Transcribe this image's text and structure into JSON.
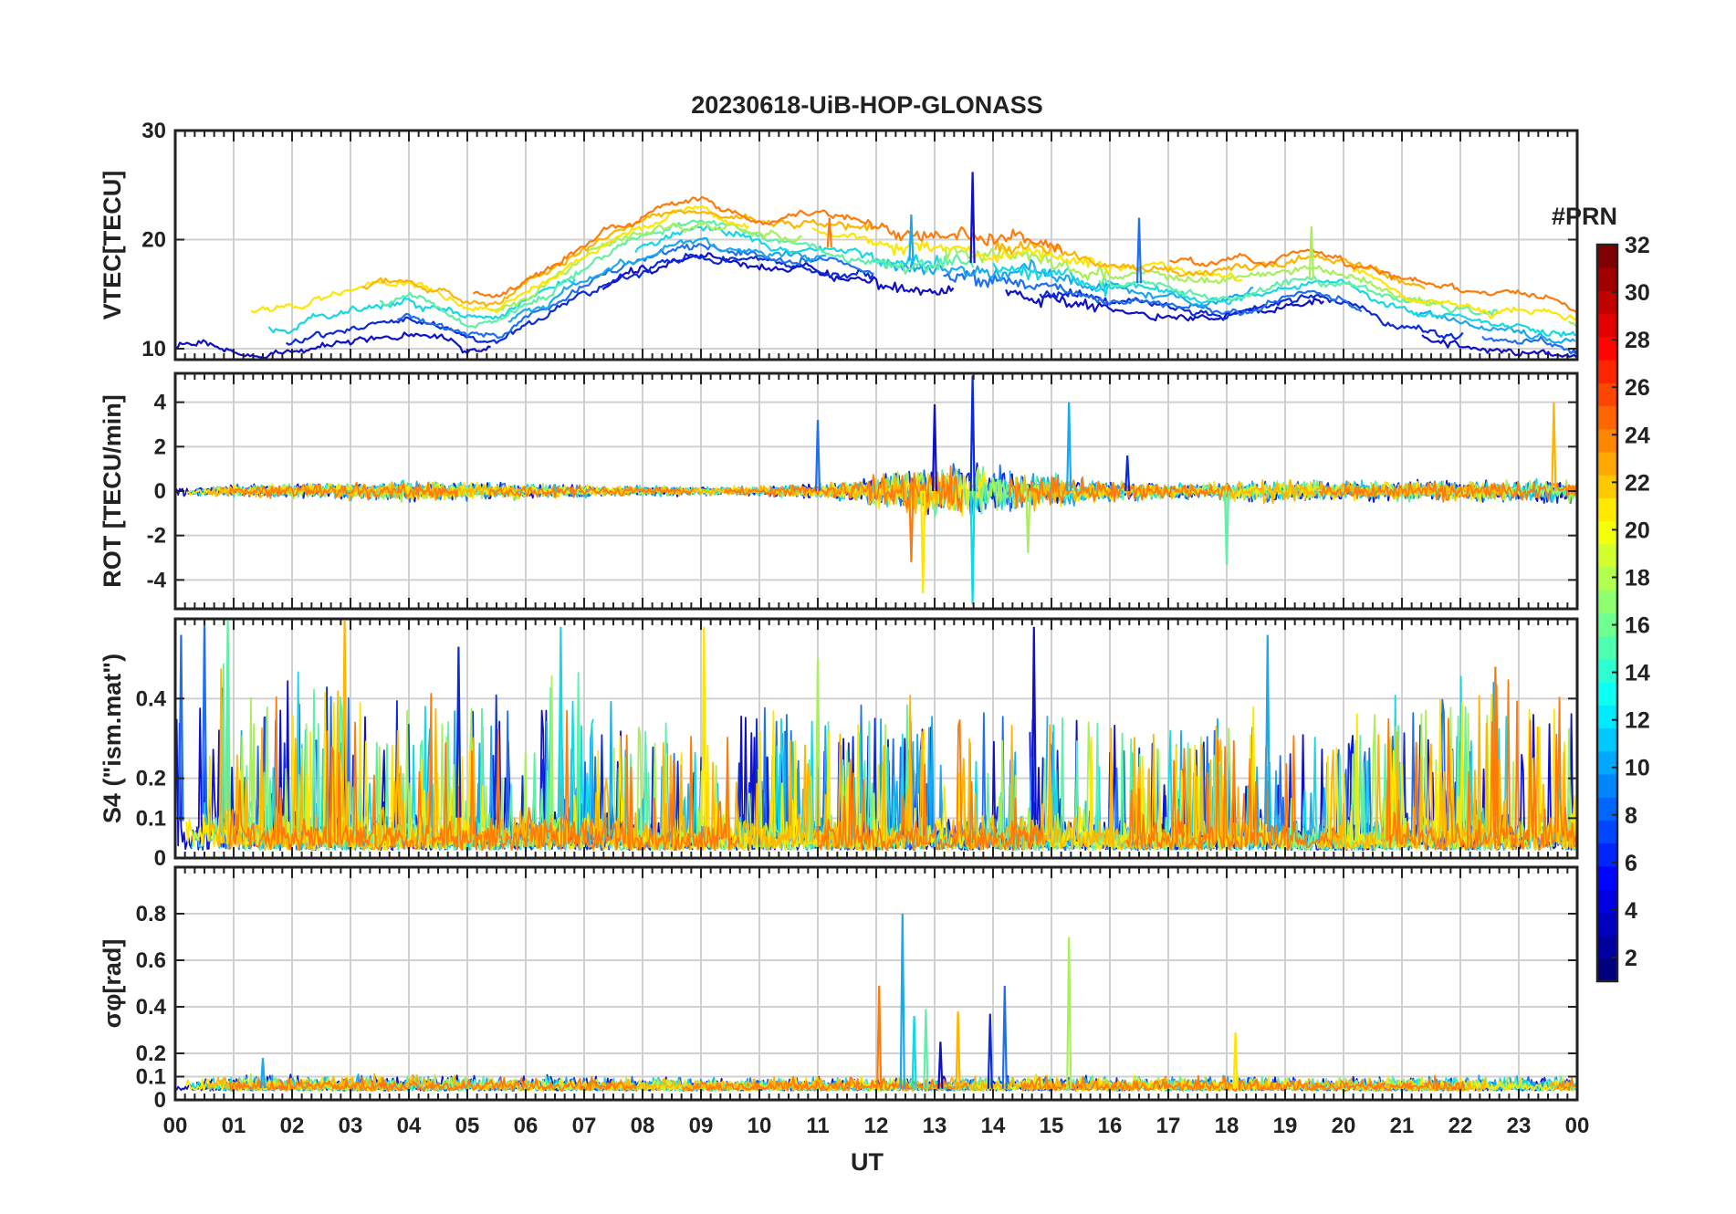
{
  "chart_data": {
    "type": "line",
    "title": "20230618-UiB-HOP-GLONASS",
    "xlabel": "UT",
    "xlim": [
      0,
      24
    ],
    "x_ticks": [
      0,
      1,
      2,
      3,
      4,
      5,
      6,
      7,
      8,
      9,
      10,
      11,
      12,
      13,
      14,
      15,
      16,
      17,
      18,
      19,
      20,
      21,
      22,
      23,
      24
    ],
    "x_tick_labels": [
      "00",
      "01",
      "02",
      "03",
      "04",
      "05",
      "06",
      "07",
      "08",
      "09",
      "10",
      "11",
      "12",
      "13",
      "14",
      "15",
      "16",
      "17",
      "18",
      "19",
      "20",
      "21",
      "22",
      "23",
      "00"
    ],
    "grid": true,
    "panels": [
      {
        "id": "vtec",
        "ylabel": "VTEC[TECU]",
        "ylim": [
          9,
          30
        ],
        "y_ticks": [
          10,
          20,
          30
        ],
        "y_tick_labels": [
          "10",
          "20",
          "30"
        ],
        "profile": [
          [
            0,
            12.5
          ],
          [
            0.5,
            13
          ],
          [
            1,
            12.5
          ],
          [
            1.5,
            12
          ],
          [
            2,
            12.5
          ],
          [
            2.5,
            13
          ],
          [
            3,
            13.5
          ],
          [
            3.5,
            14
          ],
          [
            4,
            14.5
          ],
          [
            4.5,
            14
          ],
          [
            5,
            12.5
          ],
          [
            5.5,
            12.5
          ],
          [
            6,
            14
          ],
          [
            6.5,
            15.5
          ],
          [
            7,
            17
          ],
          [
            7.5,
            18.5
          ],
          [
            8,
            19.5
          ],
          [
            8.5,
            20.5
          ],
          [
            9,
            21
          ],
          [
            9.5,
            20.5
          ],
          [
            10,
            20
          ],
          [
            10.5,
            19.5
          ],
          [
            11,
            19.5
          ],
          [
            11.5,
            19
          ],
          [
            12,
            18.5
          ],
          [
            12.5,
            18
          ],
          [
            13,
            18
          ],
          [
            13.5,
            18
          ],
          [
            14,
            17.5
          ],
          [
            14.5,
            17.5
          ],
          [
            15,
            17
          ],
          [
            15.5,
            16.5
          ],
          [
            16,
            16
          ],
          [
            16.5,
            16
          ],
          [
            17,
            15.5
          ],
          [
            17.5,
            15
          ],
          [
            18,
            15
          ],
          [
            18.5,
            15.5
          ],
          [
            19,
            16
          ],
          [
            19.5,
            16.5
          ],
          [
            20,
            16
          ],
          [
            20.5,
            15
          ],
          [
            21,
            14
          ],
          [
            21.5,
            13.5
          ],
          [
            22,
            13
          ],
          [
            22.5,
            12.5
          ],
          [
            23,
            12.5
          ],
          [
            23.5,
            12
          ],
          [
            24,
            11.5
          ]
        ],
        "spikes": [
          [
            13.65,
            26.2
          ],
          [
            12.6,
            22.3
          ],
          [
            19.45,
            21.2
          ],
          [
            11.2,
            22
          ],
          [
            16.5,
            22
          ]
        ]
      },
      {
        "id": "rot",
        "ylabel": "ROT [TECU/min]",
        "ylim": [
          -5.3,
          5.3
        ],
        "y_ticks": [
          -4,
          -2,
          0,
          2,
          4
        ],
        "y_tick_labels": [
          "-4",
          "-2",
          "0",
          "2",
          "4"
        ],
        "profile": [
          [
            0,
            0.4
          ],
          [
            1,
            0.5
          ],
          [
            2,
            0.6
          ],
          [
            3,
            0.7
          ],
          [
            4,
            0.8
          ],
          [
            5,
            0.7
          ],
          [
            6,
            0.6
          ],
          [
            7,
            0.5
          ],
          [
            8,
            0.4
          ],
          [
            9,
            0.35
          ],
          [
            10,
            0.4
          ],
          [
            11,
            0.6
          ],
          [
            11.8,
            0.9
          ],
          [
            12,
            1.4
          ],
          [
            12.5,
            1.8
          ],
          [
            13,
            2.0
          ],
          [
            13.5,
            2.2
          ],
          [
            14,
            2.0
          ],
          [
            14.5,
            1.6
          ],
          [
            15,
            1.4
          ],
          [
            15.5,
            1.1
          ],
          [
            16,
            0.8
          ],
          [
            17,
            0.6
          ],
          [
            18,
            0.7
          ],
          [
            18.5,
            0.9
          ],
          [
            19,
            0.9
          ],
          [
            20,
            0.8
          ],
          [
            21,
            0.8
          ],
          [
            22,
            0.8
          ],
          [
            23,
            0.9
          ],
          [
            24,
            0.9
          ]
        ],
        "spikes": [
          [
            13.65,
            5.2
          ],
          [
            13.65,
            -5.1
          ],
          [
            12.8,
            -4.6
          ],
          [
            13.0,
            3.9
          ],
          [
            15.3,
            4.0
          ],
          [
            14.6,
            -2.8
          ],
          [
            12.6,
            -3.2
          ],
          [
            11.0,
            3.2
          ],
          [
            18.0,
            -3.3
          ],
          [
            23.6,
            4.0
          ],
          [
            16.3,
            1.6
          ]
        ]
      },
      {
        "id": "s4",
        "ylabel": "S4 (\"ism.mat\")",
        "ylim": [
          0,
          0.6
        ],
        "y_ticks": [
          0,
          0.1,
          0.2,
          0.4
        ],
        "y_tick_labels": [
          "0",
          "0.1",
          "0.2",
          "0.4"
        ],
        "profile": [
          [
            0,
            0.22
          ],
          [
            0.5,
            0.28
          ],
          [
            1,
            0.3
          ],
          [
            1.5,
            0.28
          ],
          [
            2,
            0.26
          ],
          [
            2.5,
            0.26
          ],
          [
            3,
            0.26
          ],
          [
            3.5,
            0.2
          ],
          [
            4,
            0.22
          ],
          [
            4.5,
            0.24
          ],
          [
            5,
            0.26
          ],
          [
            5.5,
            0.24
          ],
          [
            6,
            0.22
          ],
          [
            6.5,
            0.26
          ],
          [
            7,
            0.26
          ],
          [
            7.5,
            0.24
          ],
          [
            8,
            0.2
          ],
          [
            8.5,
            0.18
          ],
          [
            9,
            0.2
          ],
          [
            9.5,
            0.22
          ],
          [
            10,
            0.22
          ],
          [
            10.5,
            0.22
          ],
          [
            11,
            0.2
          ],
          [
            11.5,
            0.2
          ],
          [
            12,
            0.22
          ],
          [
            12.5,
            0.22
          ],
          [
            13,
            0.24
          ],
          [
            13.5,
            0.22
          ],
          [
            14,
            0.22
          ],
          [
            14.5,
            0.24
          ],
          [
            15,
            0.24
          ],
          [
            15.5,
            0.22
          ],
          [
            16,
            0.2
          ],
          [
            16.5,
            0.18
          ],
          [
            17,
            0.18
          ],
          [
            17.5,
            0.18
          ],
          [
            18,
            0.2
          ],
          [
            18.5,
            0.22
          ],
          [
            19,
            0.2
          ],
          [
            19.5,
            0.18
          ],
          [
            20,
            0.18
          ],
          [
            20.5,
            0.2
          ],
          [
            21,
            0.22
          ],
          [
            21.5,
            0.24
          ],
          [
            22,
            0.24
          ],
          [
            22.5,
            0.26
          ],
          [
            23,
            0.26
          ],
          [
            23.5,
            0.26
          ],
          [
            24,
            0.26
          ]
        ],
        "spikes": [
          [
            0.5,
            0.6
          ],
          [
            0.9,
            0.6
          ],
          [
            2.9,
            0.6
          ],
          [
            4.85,
            0.53
          ],
          [
            6.6,
            0.58
          ],
          [
            9.05,
            0.58
          ],
          [
            14.7,
            0.58
          ],
          [
            18.7,
            0.56
          ],
          [
            11.0,
            0.5
          ],
          [
            22.6,
            0.48
          ],
          [
            0.1,
            0.56
          ]
        ]
      },
      {
        "id": "sigma-phi",
        "ylabel": "σφ[rad]",
        "ylim": [
          0,
          1.0
        ],
        "y_ticks": [
          0,
          0.1,
          0.2,
          0.4,
          0.6,
          0.8
        ],
        "y_tick_labels": [
          "0",
          "0.1",
          "0.2",
          "0.4",
          "0.6",
          "0.8"
        ],
        "profile": [
          [
            0,
            0.12
          ],
          [
            3,
            0.13
          ],
          [
            6,
            0.12
          ],
          [
            9,
            0.11
          ],
          [
            12,
            0.12
          ],
          [
            15,
            0.12
          ],
          [
            18,
            0.12
          ],
          [
            21,
            0.12
          ],
          [
            24,
            0.12
          ]
        ],
        "spikes": [
          [
            12.45,
            0.8
          ],
          [
            15.3,
            0.7
          ],
          [
            12.05,
            0.49
          ],
          [
            14.2,
            0.49
          ],
          [
            12.85,
            0.39
          ],
          [
            13.4,
            0.38
          ],
          [
            13.95,
            0.37
          ],
          [
            12.65,
            0.36
          ],
          [
            18.15,
            0.29
          ],
          [
            13.1,
            0.25
          ],
          [
            1.5,
            0.18
          ]
        ]
      }
    ],
    "colorbar": {
      "label": "#PRN",
      "range": [
        1,
        32
      ],
      "ticks": [
        2,
        4,
        6,
        8,
        10,
        12,
        14,
        16,
        18,
        20,
        22,
        24,
        26,
        28,
        30,
        32
      ],
      "tick_labels": [
        "2",
        "4",
        "6",
        "8",
        "10",
        "12",
        "14",
        "16",
        "18",
        "20",
        "22",
        "24",
        "26",
        "28",
        "30",
        "32"
      ],
      "colormap": [
        "#00007f",
        "#0000ff",
        "#007fff",
        "#00ffff",
        "#7fff7f",
        "#ffff00",
        "#ff7f00",
        "#ff0000",
        "#7f0000"
      ]
    },
    "series": [
      {
        "prn": 2,
        "color": "#1010c8"
      },
      {
        "prn": 4,
        "color": "#0a2adc"
      },
      {
        "prn": 7,
        "color": "#1f6ff0"
      },
      {
        "prn": 9,
        "color": "#1aa8f0"
      },
      {
        "prn": 12,
        "color": "#14d8e4"
      },
      {
        "prn": 15,
        "color": "#5ff0a8"
      },
      {
        "prn": 17,
        "color": "#a8f05a"
      },
      {
        "prn": 20,
        "color": "#ffe600"
      },
      {
        "prn": 22,
        "color": "#ffb400"
      },
      {
        "prn": 24,
        "color": "#ff7a0a"
      }
    ]
  }
}
